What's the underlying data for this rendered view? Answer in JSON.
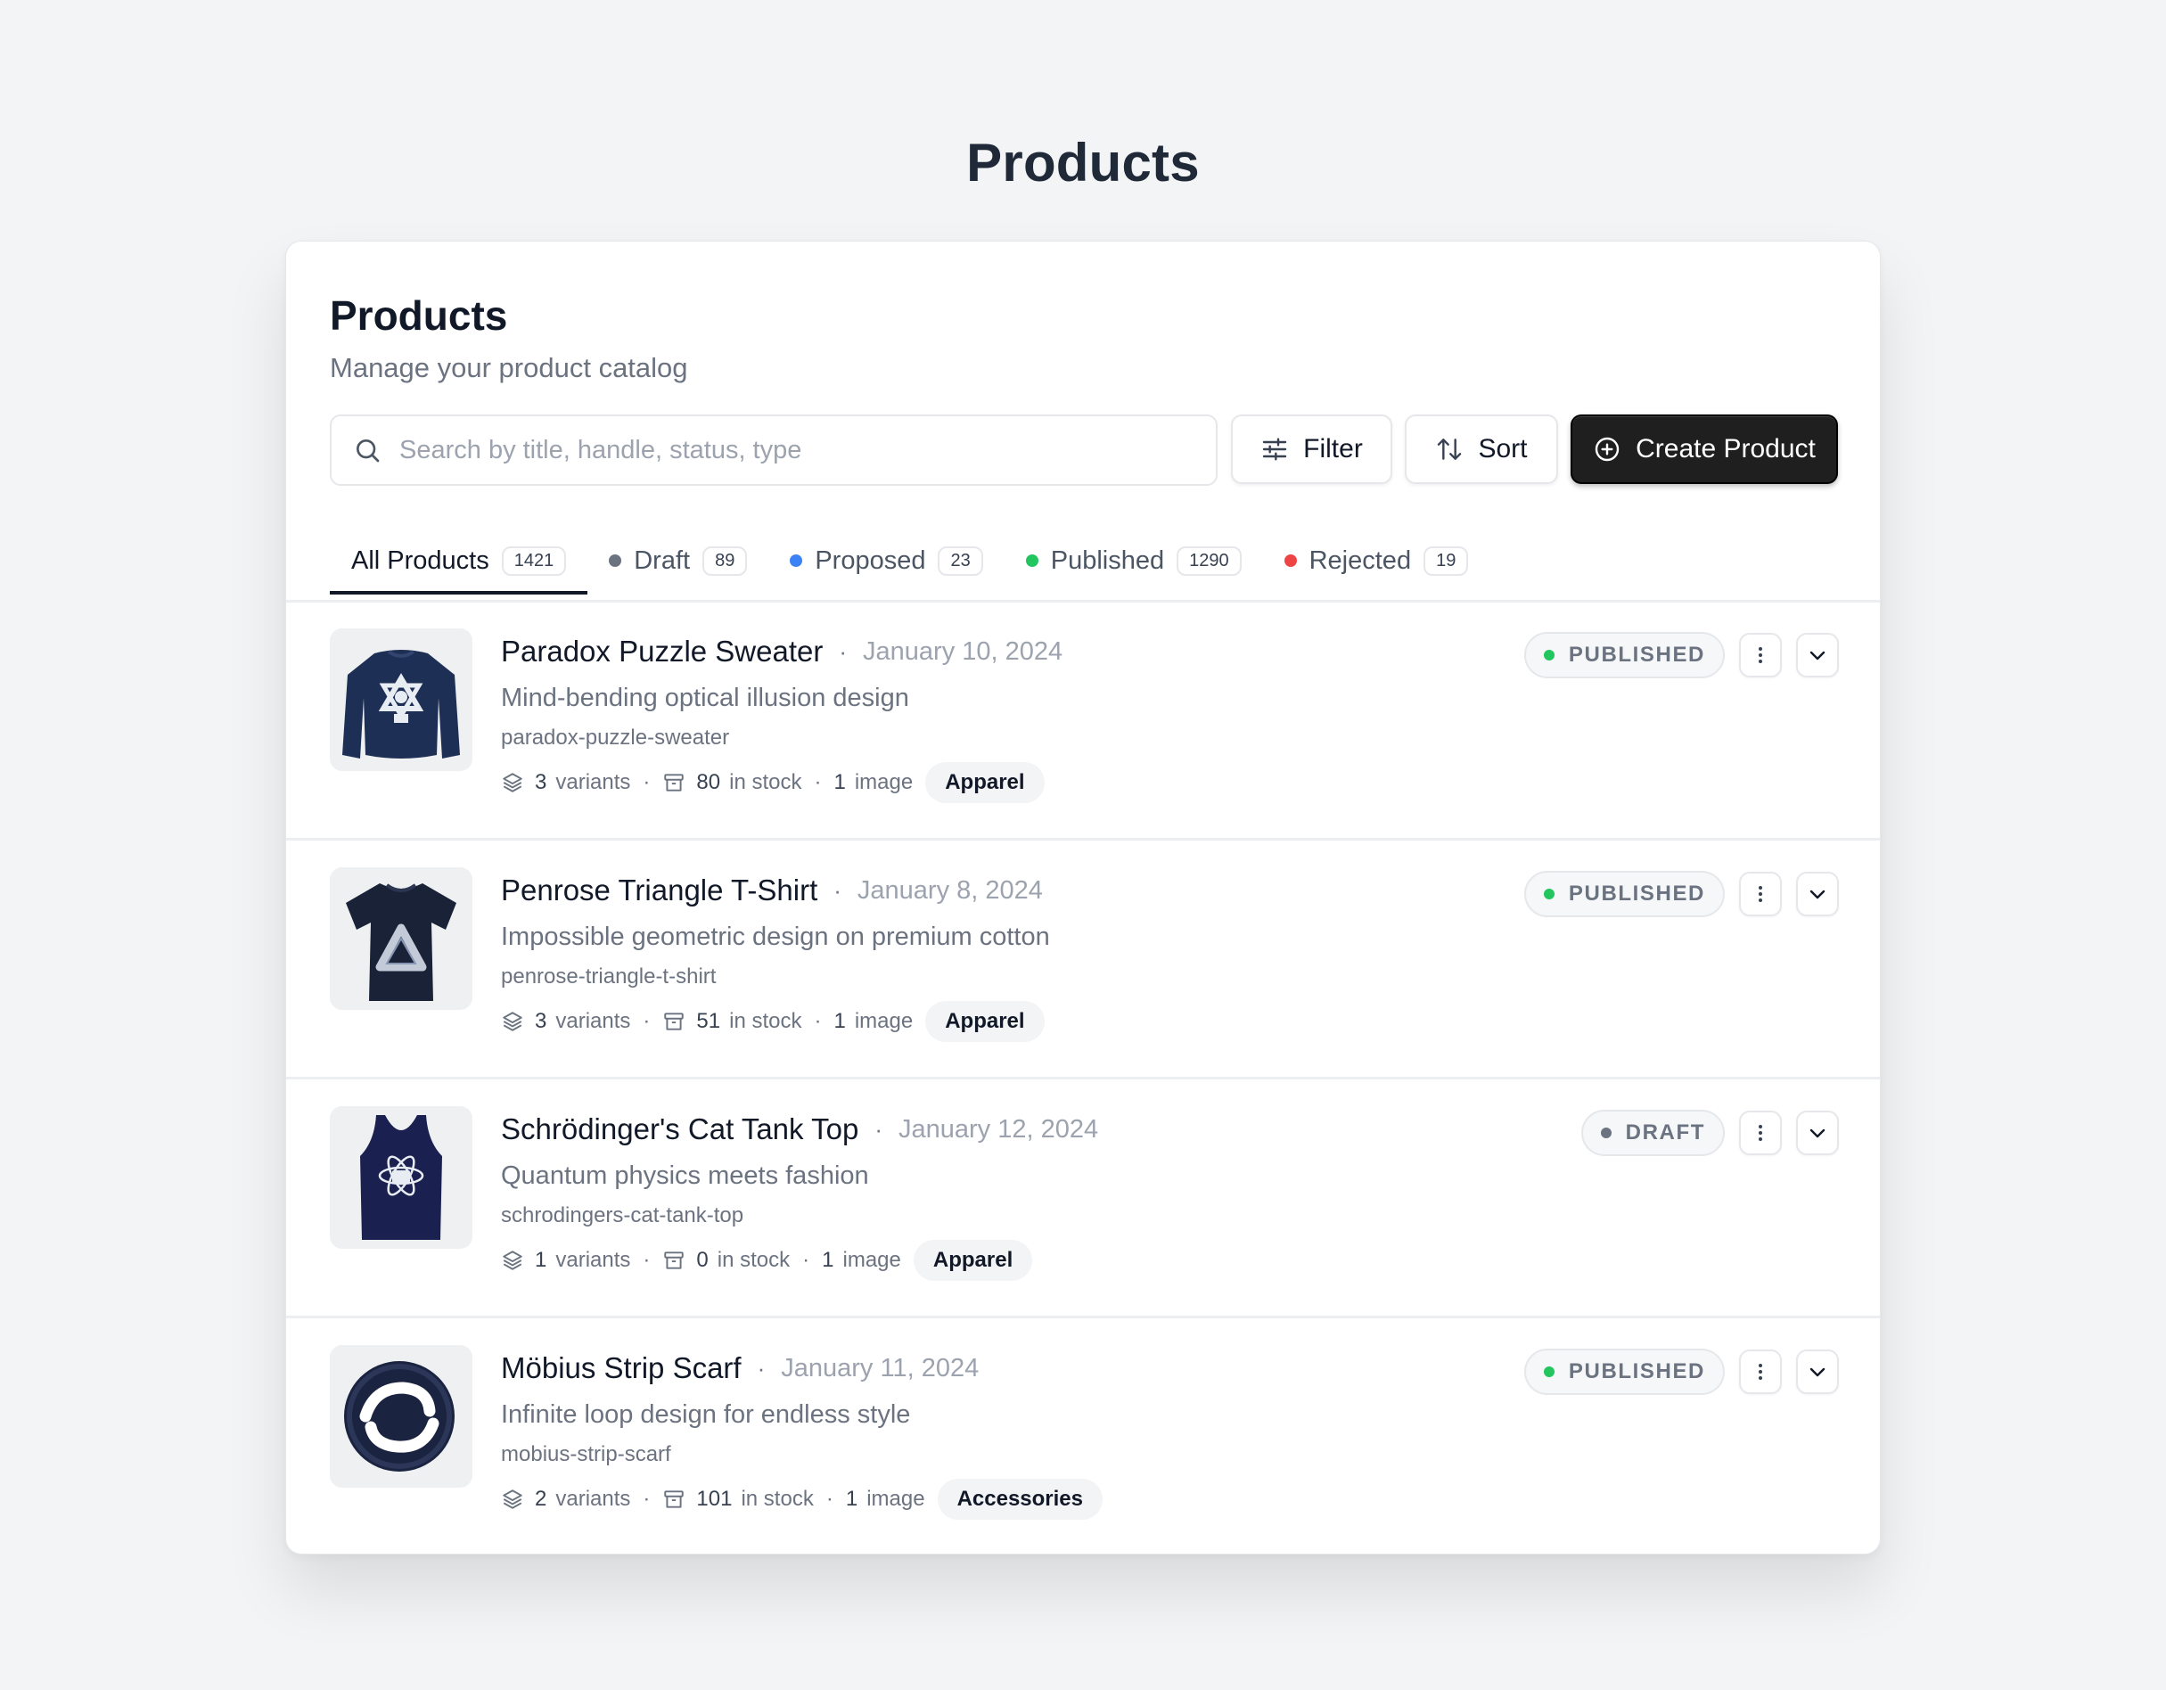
{
  "page": {
    "heading": "Products"
  },
  "card": {
    "title": "Products",
    "subtitle": "Manage your product catalog"
  },
  "search": {
    "placeholder": "Search by title, handle, status, type",
    "value": ""
  },
  "toolbar": {
    "filter_label": "Filter",
    "sort_label": "Sort",
    "create_label": "Create Product"
  },
  "tabs": [
    {
      "label": "All Products",
      "count": "1421",
      "active": true
    },
    {
      "label": "Draft",
      "count": "89",
      "dot_color": "#6b7280"
    },
    {
      "label": "Proposed",
      "count": "23",
      "dot_color": "#3b82f6"
    },
    {
      "label": "Published",
      "count": "1290",
      "dot_color": "#22c55e"
    },
    {
      "label": "Rejected",
      "count": "19",
      "dot_color": "#ef4444"
    }
  ],
  "products": [
    {
      "title": "Paradox Puzzle Sweater",
      "date": "January 10, 2024",
      "description": "Mind-bending optical illusion design",
      "handle": "paradox-puzzle-sweater",
      "variants": "3",
      "variants_label": "variants",
      "stock": "80",
      "stock_label": "in stock",
      "images": "1",
      "images_label": "image",
      "type": "Apparel",
      "status": "PUBLISHED",
      "status_color": "#22c55e",
      "image_icon": "sweater-image"
    },
    {
      "title": "Penrose Triangle T-Shirt",
      "date": "January 8, 2024",
      "description": "Impossible geometric design on premium cotton",
      "handle": "penrose-triangle-t-shirt",
      "variants": "3",
      "variants_label": "variants",
      "stock": "51",
      "stock_label": "in stock",
      "images": "1",
      "images_label": "image",
      "type": "Apparel",
      "status": "PUBLISHED",
      "status_color": "#22c55e",
      "image_icon": "tshirt-image"
    },
    {
      "title": "Schrödinger's Cat Tank Top",
      "date": "January 12, 2024",
      "description": "Quantum physics meets fashion",
      "handle": "schrodingers-cat-tank-top",
      "variants": "1",
      "variants_label": "variants",
      "stock": "0",
      "stock_label": "in stock",
      "images": "1",
      "images_label": "image",
      "type": "Apparel",
      "status": "DRAFT",
      "status_color": "#6b7280",
      "image_icon": "tank-top-image"
    },
    {
      "title": "Möbius Strip Scarf",
      "date": "January 11, 2024",
      "description": "Infinite loop design for endless style",
      "handle": "mobius-strip-scarf",
      "variants": "2",
      "variants_label": "variants",
      "stock": "101",
      "stock_label": "in stock",
      "images": "1",
      "images_label": "image",
      "type": "Accessories",
      "status": "PUBLISHED",
      "status_color": "#22c55e",
      "image_icon": "scarf-image"
    }
  ],
  "separators": {
    "title_dot": "·",
    "meta_dot": "·"
  },
  "colors": {
    "primary_button": "#1f1f1f",
    "published": "#22c55e",
    "draft": "#6b7280",
    "proposed": "#3b82f6",
    "rejected": "#ef4444"
  }
}
